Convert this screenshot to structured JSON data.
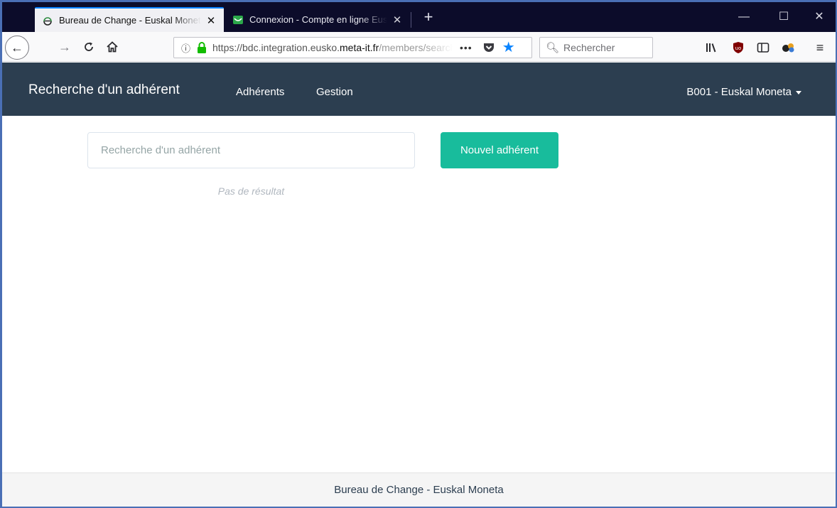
{
  "browser": {
    "tabs": [
      {
        "title": "Bureau de Change - Euskal Moneta",
        "active": true
      },
      {
        "title": "Connexion - Compte en ligne Eusko",
        "active": false
      }
    ],
    "newtab_label": "+",
    "window_controls": {
      "minimize": "—",
      "maximize": "☐",
      "close": "✕"
    },
    "url": {
      "prefix": "https://bdc.integration.eusko.",
      "domain": "meta-it.fr",
      "suffix": "/members/search"
    },
    "url_more": "•••",
    "search_placeholder": "Rechercher",
    "icons": {
      "back": "back-arrow-icon",
      "forward": "forward-arrow-icon",
      "reload": "reload-icon",
      "home": "home-icon",
      "info": "info-icon",
      "lock": "lock-icon",
      "pocket": "pocket-icon",
      "bookmark": "star-icon",
      "library": "library-icon",
      "ublock": "ublock-icon",
      "sidebar": "sidebar-icon",
      "extension": "extension-icon",
      "menu": "hamburger-menu-icon"
    },
    "colors": {
      "accent": "#0a84ff",
      "tabbar": "#0c0c2a",
      "lock": "#12bc00"
    }
  },
  "app": {
    "brand": "Recherche d'un adhérent",
    "nav_links": [
      "Adhérents",
      "Gestion"
    ],
    "user_menu": "B001 - Euskal Moneta",
    "search": {
      "placeholder": "Recherche d'un adhérent",
      "value": ""
    },
    "new_member_button": "Nouvel adhérent",
    "no_result": "Pas de résultat",
    "footer": "Bureau de Change - Euskal Moneta",
    "colors": {
      "navbar": "#2c3e50",
      "success": "#18bc9c",
      "muted": "#b0b7bf"
    }
  }
}
